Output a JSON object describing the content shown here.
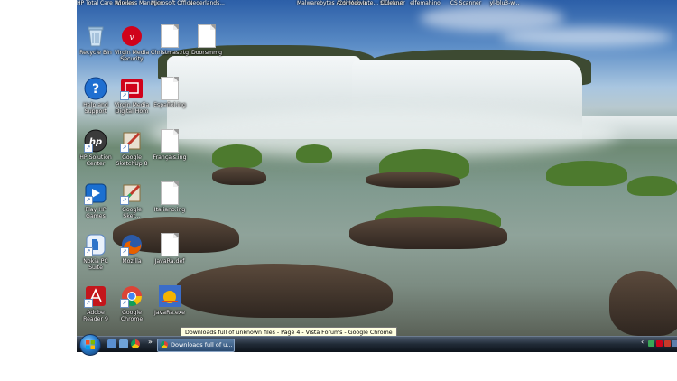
{
  "top_labels": [
    {
      "text": "HP Total Care Advisor",
      "left": 0
    },
    {
      "text": "Wireless Manager",
      "left": 0
    },
    {
      "text": "Microsoft Office",
      "left": 0
    },
    {
      "text": "Nederlands...",
      "left": 0
    },
    {
      "text": "Malwarebytes Anti-Malwa...",
      "left": 0
    },
    {
      "text": "Comodo Inte... Shortcut",
      "left": 0
    },
    {
      "text": "CCleaner",
      "left": 0
    },
    {
      "text": "elfemahino",
      "left": 0
    },
    {
      "text": "CS Scanner",
      "left": 0
    },
    {
      "text": "yl-blu3-w...",
      "left": 0
    }
  ],
  "icons": [
    {
      "name": "recycle-bin",
      "label": "Recycle Bin",
      "kind": "bin"
    },
    {
      "name": "virgin-media-security",
      "label": "Virgin Media Security",
      "kind": "virgin"
    },
    {
      "name": "christmas-rtf",
      "label": "Christmas.rtg",
      "kind": "doc"
    },
    {
      "name": "doorsmmg",
      "label": "Doorsmmg",
      "kind": "doc"
    },
    {
      "name": "help-and-support",
      "label": "Help and Support",
      "kind": "help"
    },
    {
      "name": "virgin-media-digital-home",
      "label": "Virgin Media Digital Hom",
      "kind": "virginhome"
    },
    {
      "name": "espanol",
      "label": "Español.ing",
      "kind": "doc"
    },
    {
      "name": "hp-solution-center",
      "label": "HP Solution Center",
      "kind": "hp"
    },
    {
      "name": "google-sketchup",
      "label": "Google SketchUp 8",
      "kind": "sketchup"
    },
    {
      "name": "francais",
      "label": "Français.ing",
      "kind": "doc"
    },
    {
      "name": "play-hp-games",
      "label": "Play HP Games",
      "kind": "games"
    },
    {
      "name": "google-sketchup-2",
      "label": "Google Sket...",
      "kind": "sketchup"
    },
    {
      "name": "italiano",
      "label": "Italiano.ing",
      "kind": "doc"
    },
    {
      "name": "nokia-pc-suite",
      "label": "Nokia PC Suite",
      "kind": "nokia"
    },
    {
      "name": "mozilla",
      "label": "Mozilla",
      "kind": "firefox"
    },
    {
      "name": "javara-def",
      "label": "JavaRa.def",
      "kind": "doc"
    },
    {
      "name": "adobe-reader",
      "label": "Adobe Reader 9",
      "kind": "adobe"
    },
    {
      "name": "google-chrome",
      "label": "Google Chrome",
      "kind": "chrome"
    },
    {
      "name": "javara-exe",
      "label": "JavaRa.exe",
      "kind": "javara"
    }
  ],
  "tooltip": {
    "text": "Downloads full of unknown files - Page 4 - Vista Forums - Google Chrome"
  },
  "taskbar": {
    "quick_launch_more": "»",
    "active_task_label": "Downloads full of u..."
  },
  "colors": {
    "taskbar": "#1a2330",
    "tooltip_bg": "#ffffe1",
    "desktop_text": "#ffffff"
  }
}
